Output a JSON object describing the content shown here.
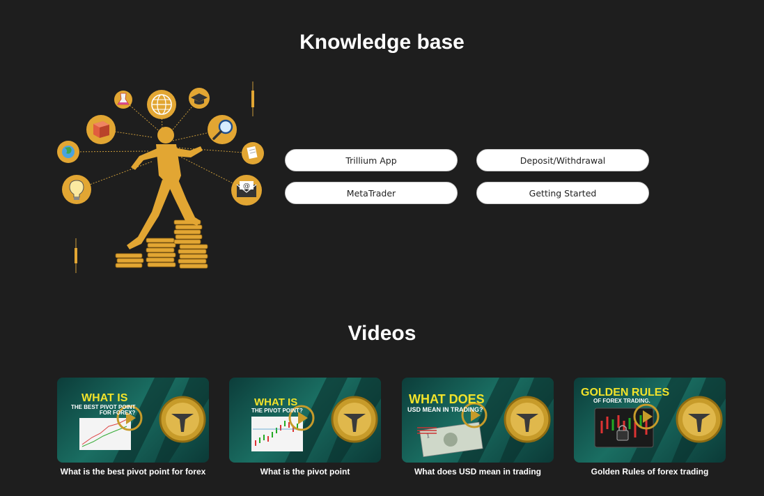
{
  "knowledge_base": {
    "title": "Knowledge base",
    "buttons": [
      {
        "label": "Trillium App"
      },
      {
        "label": "Deposit/Withdrawal"
      },
      {
        "label": "MetaTrader"
      },
      {
        "label": "Getting Started"
      }
    ]
  },
  "videos": {
    "title": "Videos",
    "items": [
      {
        "caption": "What is the best pivot point for forex",
        "thumb_headline": "WHAT IS",
        "thumb_sub": "THE BEST PIVOT POINT\nFOR FOREX?"
      },
      {
        "caption": "What is the pivot point",
        "thumb_headline": "WHAT IS",
        "thumb_sub": "THE PIVOT POINT?"
      },
      {
        "caption": "What does USD mean in trading",
        "thumb_headline": "WHAT DOES",
        "thumb_sub": "USD MEAN IN TRADING?"
      },
      {
        "caption": "Golden Rules of forex trading",
        "thumb_headline": "GOLDEN RULES",
        "thumb_sub": "OF FOREX TRADING."
      }
    ]
  },
  "colors": {
    "background": "#1e1e1e",
    "accent_gold": "#e2a633",
    "thumb_yellow": "#f2e32a"
  },
  "icons": [
    "flask-icon",
    "globe-icon",
    "graduation-cap-icon",
    "cube-icon",
    "magnifier-icon",
    "earth-icon",
    "document-icon",
    "lightbulb-icon",
    "email-icon",
    "play-icon",
    "coin-logo-icon"
  ]
}
